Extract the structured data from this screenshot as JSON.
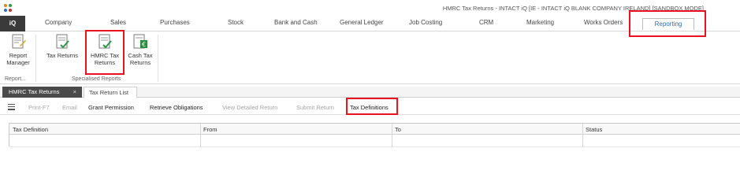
{
  "window": {
    "title": "HMRC Tax Returns - INTACT iQ [IE - INTACT iQ BLANK COMPANY IRELAND] [SANDBOX MODE]"
  },
  "ribbon_tabs": {
    "iq": "iQ",
    "company": "Company",
    "sales": "Sales",
    "purchases": "Purchases",
    "stock": "Stock",
    "bank_and_cash": "Bank and Cash",
    "general_ledger": "General Ledger",
    "job_costing": "Job Costing",
    "crm": "CRM",
    "marketing": "Marketing",
    "works_orders": "Works Orders",
    "reporting": "Reporting"
  },
  "ribbon": {
    "report_manager": {
      "line1": "Report",
      "line2": "Manager"
    },
    "tax_returns": "Tax Returns",
    "hmrc_tax_returns": {
      "line1": "HMRC Tax",
      "line2": "Returns"
    },
    "cash_tax_returns": {
      "line1": "Cash Tax",
      "line2": "Returns"
    },
    "group_report": "Report...",
    "group_specialised": "Specialised Reports"
  },
  "doc_tabs": {
    "active": "HMRC Tax Returns",
    "close_glyph": "×",
    "second": "Tax Return List"
  },
  "toolbar": {
    "print": "Print-F7",
    "email": "Email",
    "grant_permission": "Grant Permission",
    "retrieve_obligations": "Retrieve Obligations",
    "view_detailed_return": "View Detailed Return",
    "submit_return": "Submit Return",
    "tax_definitions": "Tax Definitions"
  },
  "grid": {
    "columns": [
      "Tax Definition",
      "From",
      "To",
      "Status"
    ]
  },
  "colors": {
    "highlight_red": "#e8131c",
    "accent_blue": "#2b6cc4",
    "iq_tab_bg": "#3a3a3a"
  }
}
